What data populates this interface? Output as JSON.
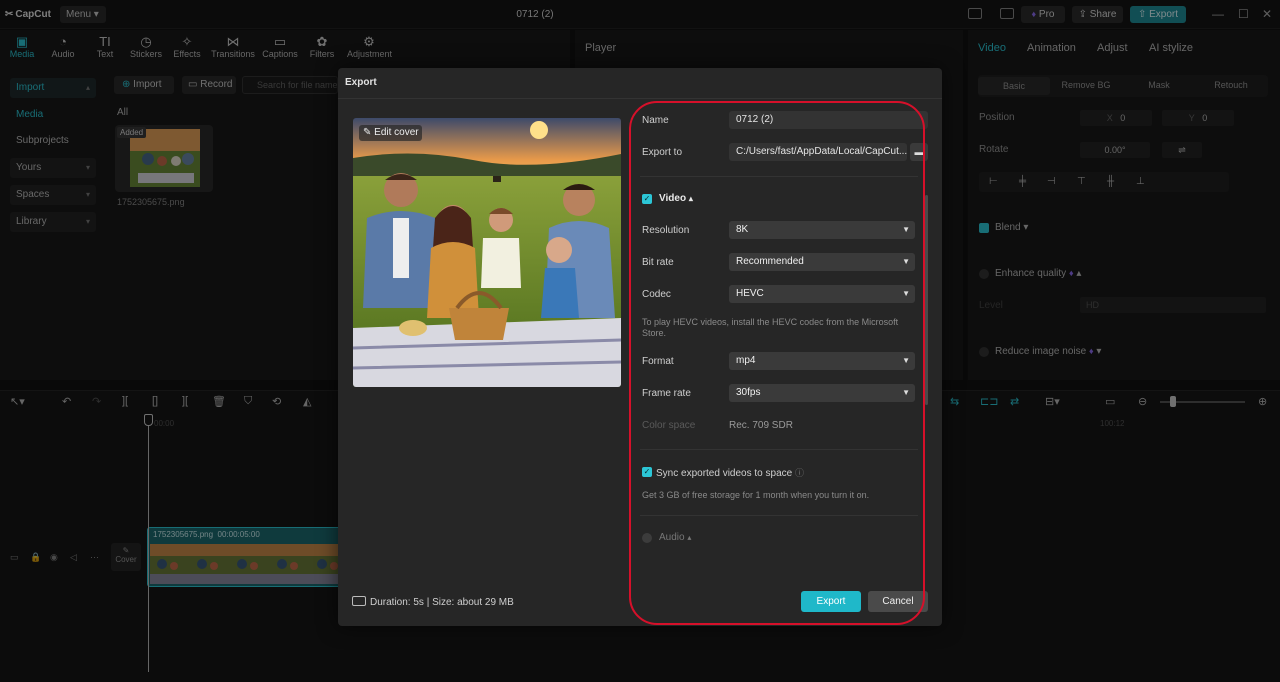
{
  "titlebar": {
    "app_name": "CapCut",
    "menu_label": "Menu",
    "project_title": "0712 (2)",
    "pro_label": "Pro",
    "share_label": "Share",
    "export_label": "Export"
  },
  "tools": [
    {
      "label": "Media",
      "icon": "media-icon"
    },
    {
      "label": "Audio",
      "icon": "audio-icon"
    },
    {
      "label": "Text",
      "icon": "text-icon"
    },
    {
      "label": "Stickers",
      "icon": "stickers-icon"
    },
    {
      "label": "Effects",
      "icon": "effects-icon"
    },
    {
      "label": "Transitions",
      "icon": "transitions-icon"
    },
    {
      "label": "Captions",
      "icon": "captions-icon"
    },
    {
      "label": "Filters",
      "icon": "filters-icon"
    },
    {
      "label": "Adjustment",
      "icon": "adjustment-icon"
    }
  ],
  "sidebar": {
    "items": [
      "Import",
      "Media",
      "Subprojects",
      "Yours",
      "Spaces",
      "Library"
    ]
  },
  "media": {
    "import_label": "Import",
    "record_label": "Record",
    "search_placeholder": "Search for file name",
    "all_label": "All",
    "added_badge": "Added",
    "file_name": "1752305675.png"
  },
  "player": {
    "title": "Player"
  },
  "right_panel": {
    "tabs": [
      "Video",
      "Animation",
      "Adjust",
      "AI stylize"
    ],
    "subtabs": [
      "Basic",
      "Remove BG",
      "Mask",
      "Retouch"
    ],
    "position_label": "Position",
    "pos_x_label": "X",
    "pos_x": "0",
    "pos_y_label": "Y",
    "pos_y": "0",
    "rotate_label": "Rotate",
    "rotate_value": "0.00°",
    "blend_label": "Blend",
    "enhance_label": "Enhance quality",
    "level_label": "Level",
    "level_value": "HD",
    "noise_label": "Reduce image noise"
  },
  "timeline": {
    "ruler_start": "00:00",
    "ruler_mark": "100:12",
    "cover_label": "Cover",
    "clip_label": "1752305675.png",
    "clip_duration": "00:00:05:00"
  },
  "export_dialog": {
    "title": "Export",
    "edit_cover_label": "Edit cover",
    "duration_info": "Duration: 5s | Size: about 29 MB",
    "name_label": "Name",
    "name_value": "0712 (2)",
    "export_to_label": "Export to",
    "export_to_value": "C:/Users/fast/AppData/Local/CapCut...",
    "video_section": "Video",
    "resolution_label": "Resolution",
    "resolution_value": "8K",
    "bitrate_label": "Bit rate",
    "bitrate_value": "Recommended",
    "codec_label": "Codec",
    "codec_value": "HEVC",
    "codec_note": "To play HEVC videos, install the HEVC codec from the Microsoft Store.",
    "format_label": "Format",
    "format_value": "mp4",
    "framerate_label": "Frame rate",
    "framerate_value": "30fps",
    "colorspace_label": "Color space",
    "colorspace_value": "Rec. 709 SDR",
    "sync_label": "Sync exported videos to space",
    "sync_note": "Get 3 GB of free storage for 1 month when you turn it on.",
    "audio_section": "Audio",
    "export_button": "Export",
    "cancel_button": "Cancel"
  },
  "colors": {
    "accent": "#2cc6d6",
    "export_button": "#1fb8c9",
    "highlight": "#d6102a"
  }
}
